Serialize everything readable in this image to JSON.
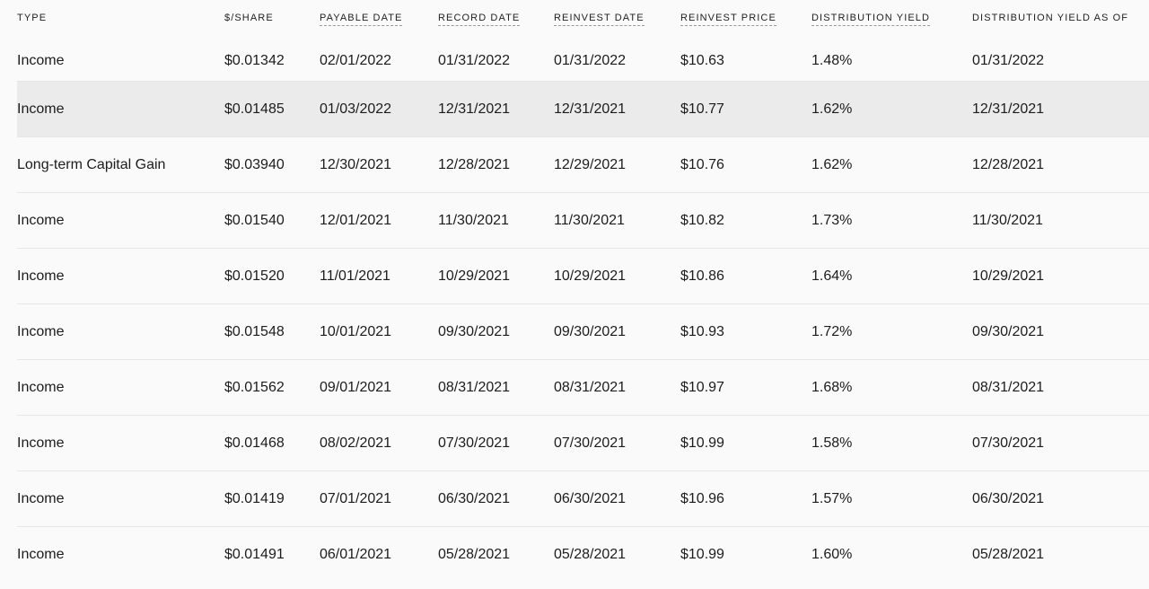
{
  "table": {
    "headers": {
      "type": "TYPE",
      "per_share": "$/SHARE",
      "payable_date": "PAYABLE DATE",
      "record_date": "RECORD DATE",
      "reinvest_date": "REINVEST DATE",
      "reinvest_price": "REINVEST PRICE",
      "distribution_yield": "DISTRIBUTION YIELD",
      "distribution_yield_as_of": "DISTRIBUTION YIELD AS OF"
    },
    "rows": [
      {
        "type": "Income",
        "per_share": "$0.01342",
        "payable_date": "02/01/2022",
        "record_date": "01/31/2022",
        "reinvest_date": "01/31/2022",
        "reinvest_price": "$10.63",
        "distribution_yield": "1.48%",
        "distribution_yield_as_of": "01/31/2022"
      },
      {
        "type": "Income",
        "per_share": "$0.01485",
        "payable_date": "01/03/2022",
        "record_date": "12/31/2021",
        "reinvest_date": "12/31/2021",
        "reinvest_price": "$10.77",
        "distribution_yield": "1.62%",
        "distribution_yield_as_of": "12/31/2021"
      },
      {
        "type": "Long-term Capital Gain",
        "per_share": "$0.03940",
        "payable_date": "12/30/2021",
        "record_date": "12/28/2021",
        "reinvest_date": "12/29/2021",
        "reinvest_price": "$10.76",
        "distribution_yield": "1.62%",
        "distribution_yield_as_of": "12/28/2021"
      },
      {
        "type": "Income",
        "per_share": "$0.01540",
        "payable_date": "12/01/2021",
        "record_date": "11/30/2021",
        "reinvest_date": "11/30/2021",
        "reinvest_price": "$10.82",
        "distribution_yield": "1.73%",
        "distribution_yield_as_of": "11/30/2021"
      },
      {
        "type": "Income",
        "per_share": "$0.01520",
        "payable_date": "11/01/2021",
        "record_date": "10/29/2021",
        "reinvest_date": "10/29/2021",
        "reinvest_price": "$10.86",
        "distribution_yield": "1.64%",
        "distribution_yield_as_of": "10/29/2021"
      },
      {
        "type": "Income",
        "per_share": "$0.01548",
        "payable_date": "10/01/2021",
        "record_date": "09/30/2021",
        "reinvest_date": "09/30/2021",
        "reinvest_price": "$10.93",
        "distribution_yield": "1.72%",
        "distribution_yield_as_of": "09/30/2021"
      },
      {
        "type": "Income",
        "per_share": "$0.01562",
        "payable_date": "09/01/2021",
        "record_date": "08/31/2021",
        "reinvest_date": "08/31/2021",
        "reinvest_price": "$10.97",
        "distribution_yield": "1.68%",
        "distribution_yield_as_of": "08/31/2021"
      },
      {
        "type": "Income",
        "per_share": "$0.01468",
        "payable_date": "08/02/2021",
        "record_date": "07/30/2021",
        "reinvest_date": "07/30/2021",
        "reinvest_price": "$10.99",
        "distribution_yield": "1.58%",
        "distribution_yield_as_of": "07/30/2021"
      },
      {
        "type": "Income",
        "per_share": "$0.01419",
        "payable_date": "07/01/2021",
        "record_date": "06/30/2021",
        "reinvest_date": "06/30/2021",
        "reinvest_price": "$10.96",
        "distribution_yield": "1.57%",
        "distribution_yield_as_of": "06/30/2021"
      },
      {
        "type": "Income",
        "per_share": "$0.01491",
        "payable_date": "06/01/2021",
        "record_date": "05/28/2021",
        "reinvest_date": "05/28/2021",
        "reinvest_price": "$10.99",
        "distribution_yield": "1.60%",
        "distribution_yield_as_of": "05/28/2021"
      }
    ],
    "highlighted_row": 1
  },
  "colors": {
    "background": "#fafafa",
    "highlight_row": "#ebebeb",
    "divider": "#e6e6e6",
    "text": "#1c1c1c"
  }
}
